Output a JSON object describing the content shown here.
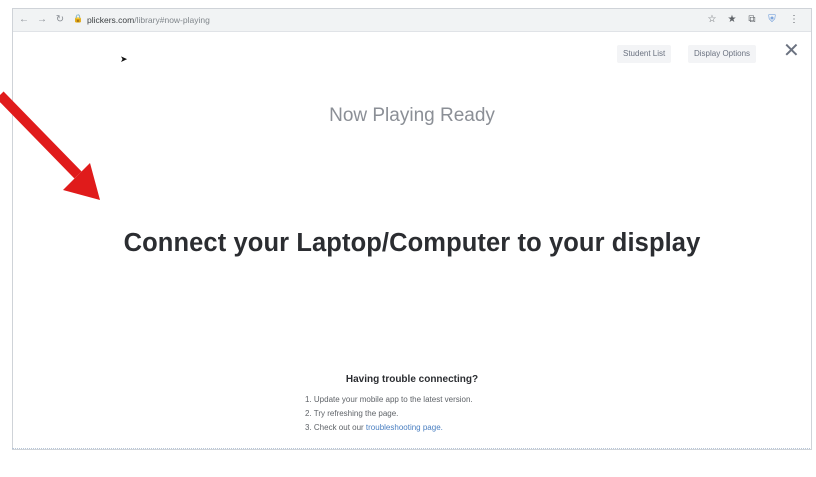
{
  "browser": {
    "url_host": "plickers.com",
    "url_path": "/library#now-playing"
  },
  "toolbar": {
    "student_list_label": "Student List",
    "display_options_label": "Display Options",
    "close_label": "✕"
  },
  "main": {
    "title": "Now Playing Ready",
    "message": "Connect your Laptop/Computer to your display"
  },
  "trouble": {
    "heading": "Having trouble connecting?",
    "step1": "1. Update your mobile app to the latest version.",
    "step2": "2. Try refreshing the page.",
    "step3_prefix": "3. Check out our ",
    "step3_link": "troubleshooting page."
  },
  "annotation": {
    "arrow_color": "#e01b1b"
  },
  "icons": [
    "back-icon",
    "forward-icon",
    "reload-icon",
    "lock-icon",
    "star-icon",
    "extension-icon",
    "puzzle-icon",
    "shield-icon",
    "menu-icon",
    "close-icon",
    "cursor-icon",
    "arrow-annotation-icon"
  ]
}
